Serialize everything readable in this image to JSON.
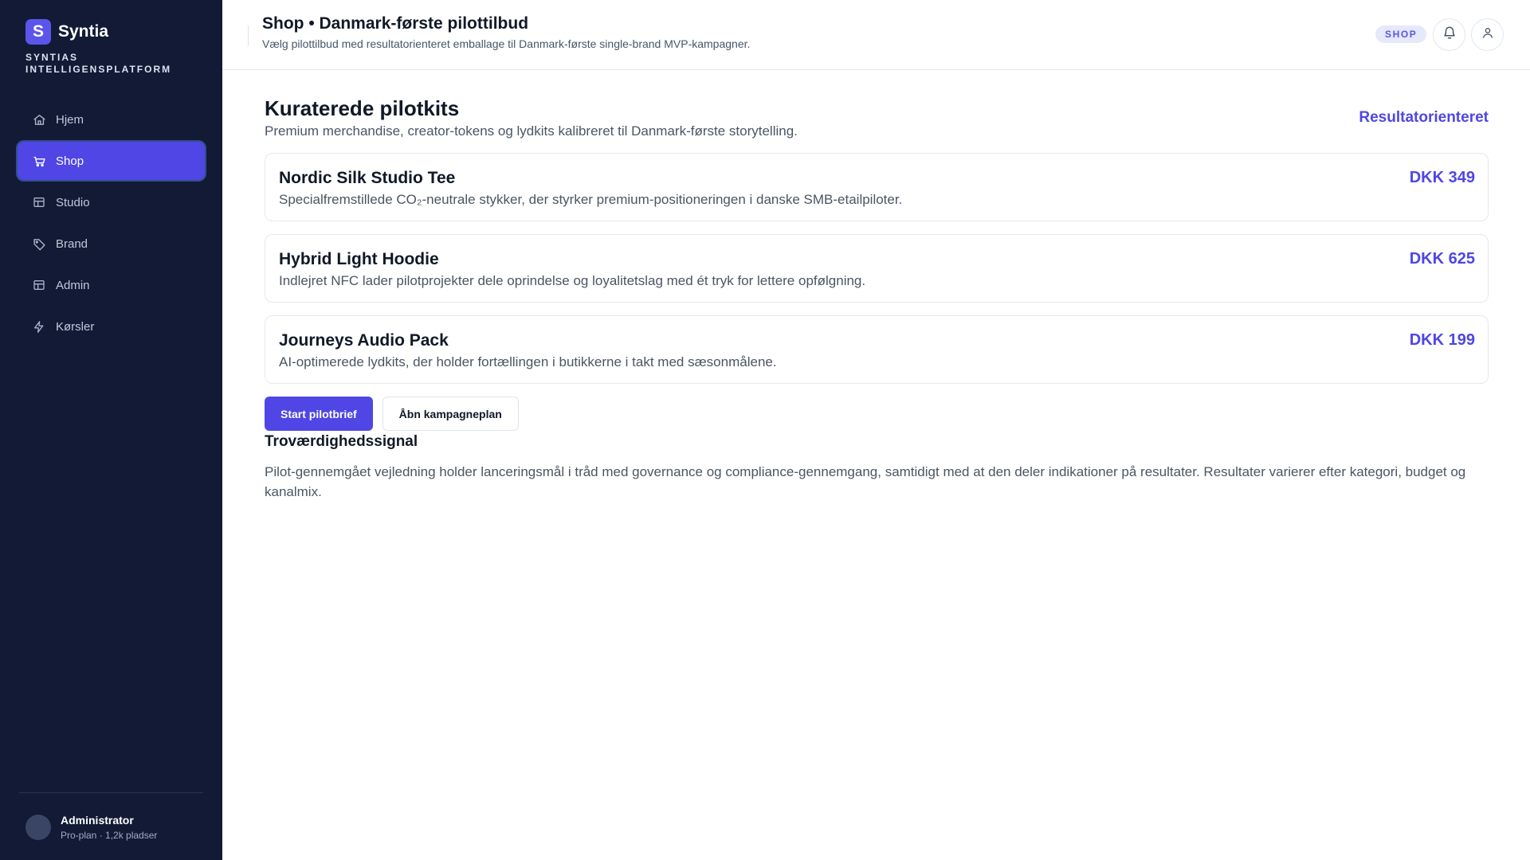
{
  "sidebar": {
    "logo_letter": "S",
    "brand_name": "Syntia",
    "brand_sub": "SYNTIAS INTELLIGENSPLATFORM",
    "items": [
      {
        "label": "Hjem",
        "icon": "home-icon"
      },
      {
        "label": "Shop",
        "icon": "cart-icon",
        "active": true
      },
      {
        "label": "Studio",
        "icon": "grid-icon"
      },
      {
        "label": "Brand",
        "icon": "tag-icon"
      },
      {
        "label": "Admin",
        "icon": "grid-icon"
      },
      {
        "label": "Kørsler",
        "icon": "bolt-icon"
      }
    ],
    "user": {
      "name": "Administrator",
      "plan": "Pro-plan · 1,2k pladser"
    }
  },
  "header": {
    "title": "Shop • Danmark-første pilottilbud",
    "subtitle": "Vælg pilottilbud med resultatorienteret emballage til Danmark-første single-brand MVP-kampagner.",
    "badge": "SHOP",
    "icons": [
      "bell-icon",
      "user-icon"
    ]
  },
  "main": {
    "section_title": "Kuraterede pilotkits",
    "section_subtitle": "Premium merchandise, creator-tokens og lydkits kalibreret til Danmark-første storytelling.",
    "section_link": "Resultatorienteret",
    "products": [
      {
        "name": "Nordic Silk Studio Tee",
        "desc": "Specialfremstillede CO₂-neutrale stykker, der styrker premium-positioneringen i danske SMB-etailpiloter.",
        "price": "DKK 349"
      },
      {
        "name": "Hybrid Light Hoodie",
        "desc": "Indlejret NFC lader pilotprojekter dele oprindelse og loyalitetslag med ét tryk for lettere opfølgning.",
        "price": "DKK 625"
      },
      {
        "name": "Journeys Audio Pack",
        "desc": "AI-optimerede lydkits, der holder fortællingen i butikkerne i takt med sæsonmålene.",
        "price": "DKK 199"
      }
    ],
    "primary_button": "Start pilotbrief",
    "secondary_button": "Åbn kampagneplan",
    "trust_title": "Troværdighedssignal",
    "trust_text": "Pilot-gennemgået vejledning holder lanceringsmål i tråd med governance og compliance-gennemgang, samtidigt med at den deler indikationer på resultater. Resultater varierer efter kategori, budget og kanalmix."
  },
  "colors": {
    "accent": "#4f46e5",
    "sidebar_bg": "#121a36"
  }
}
